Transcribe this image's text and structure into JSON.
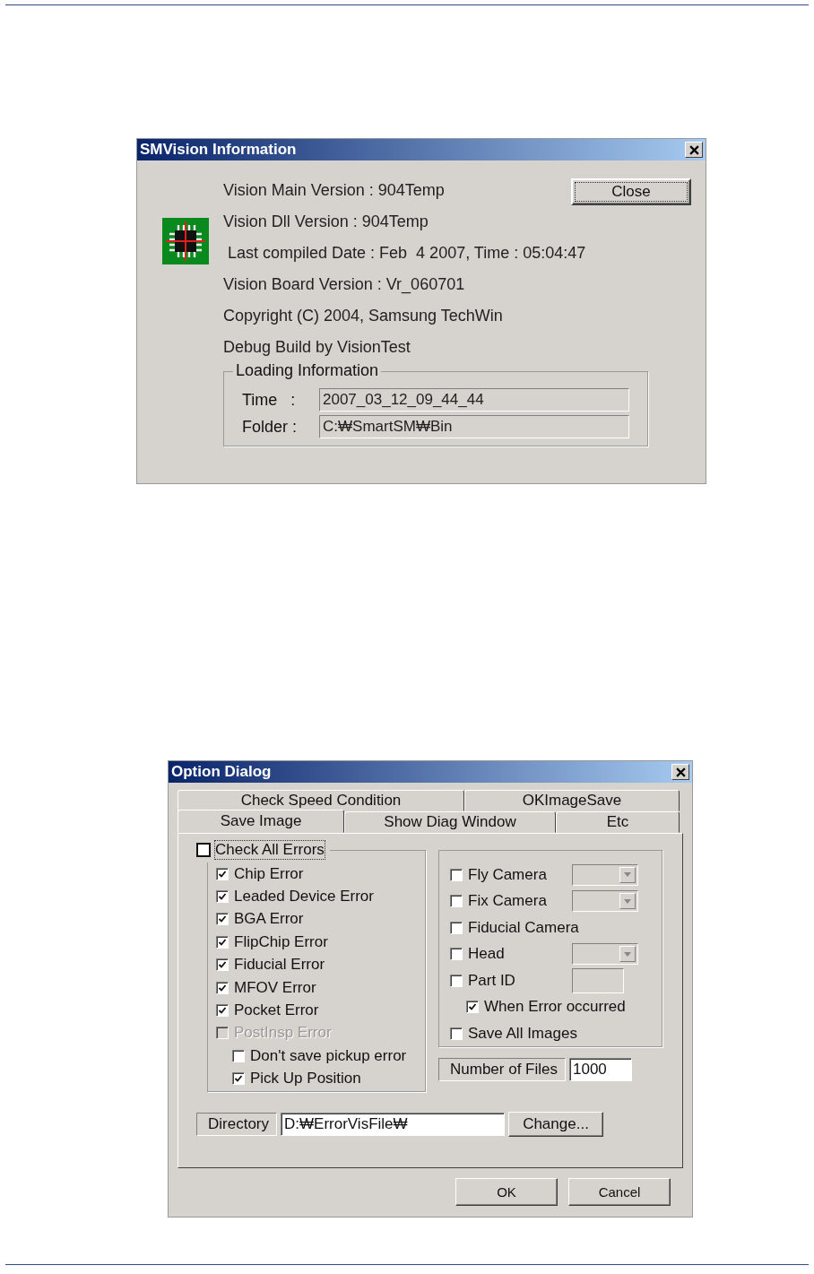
{
  "info_dialog": {
    "title": "SMVision Information",
    "lines": [
      "Vision Main Version : 904Temp",
      "Vision Dll Version : 904Temp",
      " Last compiled Date : Feb  4 2007, Time : 05:04:47",
      "Vision Board Version : Vr_060701",
      "Copyright (C) 2004, Samsung TechWin",
      "Debug Build by VisionTest"
    ],
    "close_button": "Close",
    "loading_group": {
      "title": "Loading Information",
      "fields": [
        {
          "label": "Time   :",
          "value": "2007_03_12_09_44_44"
        },
        {
          "label": "Folder :",
          "value": "C:₩SmartSM₩Bin"
        }
      ]
    }
  },
  "option_dialog": {
    "title": "Option Dialog",
    "tab_rows": [
      [
        {
          "label": "Check Speed Condition",
          "selected": false
        },
        {
          "label": "OKImageSave",
          "selected": false
        }
      ],
      [
        {
          "label": "Save Image",
          "selected": true
        },
        {
          "label": "Show Diag Window",
          "selected": false
        },
        {
          "label": "Etc",
          "selected": false
        }
      ]
    ],
    "check_all": {
      "label": "Check All Errors",
      "checked": false
    },
    "errors": [
      {
        "kind": "plain",
        "label": "Chip Error",
        "checked": true,
        "disabled": false
      },
      {
        "kind": "plain",
        "label": "Leaded Device Error",
        "checked": true,
        "disabled": false
      },
      {
        "kind": "plain",
        "label": "BGA Error",
        "checked": true,
        "disabled": false
      },
      {
        "kind": "plain",
        "label": "FlipChip Error",
        "checked": true,
        "disabled": false
      },
      {
        "kind": "plain",
        "label": "Fiducial Error",
        "checked": true,
        "disabled": false
      },
      {
        "kind": "plain",
        "label": "MFOV Error",
        "checked": true,
        "disabled": false
      },
      {
        "kind": "plain",
        "label": "Pocket Error",
        "checked": true,
        "disabled": false
      },
      {
        "kind": "plain",
        "label": "PostInsp Error",
        "checked": false,
        "disabled": true
      },
      {
        "kind": "sub",
        "label": "Don't save pickup error",
        "checked": false,
        "disabled": false
      },
      {
        "kind": "sub",
        "label": "Pick Up Position",
        "checked": true,
        "disabled": false
      }
    ],
    "cameras": [
      {
        "kind": "combo",
        "label": "Fly Camera",
        "checked": false
      },
      {
        "kind": "combo",
        "label": "Fix Camera",
        "checked": false
      },
      {
        "kind": "plain",
        "label": "Fiducial Camera",
        "checked": false
      },
      {
        "kind": "combo",
        "label": "Head",
        "checked": false
      },
      {
        "kind": "field",
        "label": "Part ID",
        "checked": false
      },
      {
        "kind": "sub",
        "label": "When Error occurred",
        "checked": true
      },
      {
        "kind": "plain",
        "label": "Save All Images",
        "checked": false
      }
    ],
    "number_of_files": {
      "label": "Number of Files",
      "value": "1000"
    },
    "directory": {
      "label": "Directory",
      "value": "D:₩ErrorVisFile₩",
      "button": "Change..."
    },
    "buttons": [
      "OK",
      "Cancel"
    ]
  }
}
